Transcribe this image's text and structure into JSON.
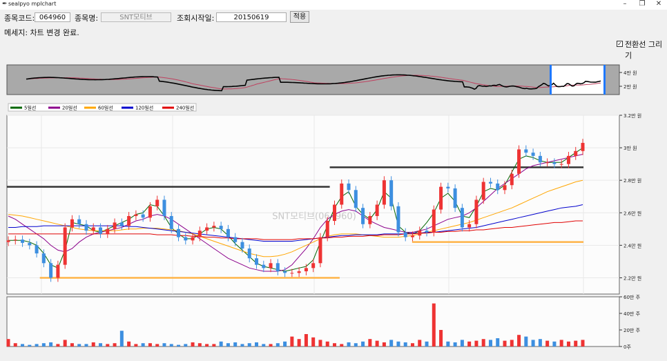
{
  "window": {
    "title": "sealpyo mplchart",
    "app_icon": "feather-icon",
    "min_label": "–",
    "max_label": "❐",
    "close_label": "✕"
  },
  "toolbar": {
    "code_label": "종목코드:",
    "code_value": "064960",
    "name_label": "종목명:",
    "name_value": "SNT모티브",
    "start_label": "조회시작일:",
    "start_value": "20150619",
    "apply_label": "적용"
  },
  "status": {
    "message": "메세지: 차트 변경 완료."
  },
  "options": {
    "transition_label": "전환선 그리기",
    "transition_checked": true
  },
  "legend": [
    {
      "name": "5일선",
      "color": "#006400"
    },
    {
      "name": "20일선",
      "color": "#8b008b"
    },
    {
      "name": "60일선",
      "color": "#ffa500"
    },
    {
      "name": "120일선",
      "color": "#0000cd"
    },
    {
      "name": "240일선",
      "color": "#e00000"
    }
  ],
  "watermark": "SNT모티브(064960)",
  "colors": {
    "up": "#ee3333",
    "down": "#3d8fe0",
    "support": "#ffb347",
    "resistance": "#333333",
    "slider": "#1e78ff"
  },
  "chart_data": {
    "type": "line",
    "overview": {
      "y_ticks": [
        "4만 원",
        "2만 원"
      ]
    },
    "price": {
      "y_ticks": [
        "3.2만 원",
        "3만 원",
        "2.8만 원",
        "2.6만 원",
        "2.4만 원",
        "2.2만 원"
      ],
      "y_values": [
        32000,
        30000,
        28000,
        26000,
        24000,
        22000
      ],
      "ylim": [
        21000,
        32000
      ],
      "x_index_range": [
        0,
        175
      ],
      "close": [
        24300,
        24350,
        24150,
        24000,
        23500,
        22900,
        22000,
        22800,
        25100,
        25600,
        25300,
        24900,
        25100,
        24700,
        25000,
        25400,
        25200,
        25800,
        25900,
        25700,
        26400,
        26800,
        25800,
        25000,
        24500,
        24300,
        24500,
        24900,
        25100,
        25200,
        25000,
        24500,
        24200,
        23800,
        23200,
        22800,
        22600,
        22900,
        22400,
        22300,
        22300,
        22400,
        22600,
        22900,
        24500,
        25500,
        26500,
        27800,
        27400,
        26300,
        25300,
        25800,
        26500,
        28000,
        26400,
        24800,
        24500,
        24600,
        24900,
        24800,
        26200,
        27600,
        27500,
        26300,
        25100,
        25300,
        26800,
        27900,
        27800,
        27400,
        27700,
        28400,
        29900,
        29700,
        29500,
        29100,
        29100,
        29000,
        29000,
        29500,
        29800,
        30300
      ],
      "ma5": [
        24300,
        24300,
        24300,
        24200,
        24000,
        23500,
        22800,
        22600,
        23700,
        25400,
        25300,
        25200,
        24900,
        24800,
        25000,
        25200,
        25400,
        25600,
        25900,
        26000,
        26500,
        26400,
        25800,
        25100,
        24700,
        24400,
        24400,
        24700,
        25000,
        25100,
        25000,
        24600,
        24100,
        23700,
        23300,
        22900,
        22700,
        22600,
        22500,
        22400,
        22500,
        22600,
        22700,
        23100,
        24200,
        25200,
        26300,
        27000,
        27300,
        26400,
        25900,
        25600,
        26200,
        27300,
        26900,
        25200,
        24800,
        24700,
        24900,
        25400,
        26000,
        26900,
        27200,
        26700,
        25800,
        25700,
        26400,
        27300,
        27500,
        27400,
        27700,
        28500,
        29300,
        29500,
        29400,
        29200,
        29100,
        29100,
        29100,
        29400,
        29700,
        30000
      ],
      "ma20": [
        25800,
        25600,
        25300,
        25000,
        24700,
        24400,
        24000,
        23700,
        23600,
        23800,
        24200,
        24500,
        24700,
        24800,
        24900,
        25000,
        25100,
        25300,
        25500,
        25600,
        25800,
        25900,
        25800,
        25600,
        25300,
        25000,
        24700,
        24400,
        24100,
        23800,
        23500,
        23200,
        23000,
        22800,
        22600,
        22500,
        22400,
        22400,
        22400,
        22500,
        22800,
        23300,
        23800,
        24400,
        25100,
        25600,
        25900,
        26100,
        26200,
        26100,
        25800,
        25500,
        25300,
        25100,
        25000,
        24900,
        24800,
        24800,
        24900,
        25000,
        25200,
        25400,
        25600,
        25700,
        25800,
        26000,
        26300,
        26700,
        27100,
        27500,
        27800,
        28100,
        28400,
        28700,
        28900,
        29000,
        29100,
        29200,
        29300,
        29400,
        29500,
        29600
      ],
      "ma60": [
        25900,
        25850,
        25800,
        25700,
        25600,
        25500,
        25400,
        25300,
        25200,
        25100,
        25000,
        24950,
        24900,
        24900,
        24900,
        24900,
        24950,
        25000,
        25000,
        25050,
        25050,
        25050,
        25000,
        24950,
        24900,
        24800,
        24700,
        24550,
        24400,
        24250,
        24100,
        23950,
        23800,
        23650,
        23500,
        23400,
        23300,
        23300,
        23350,
        23450,
        23600,
        23800,
        24000,
        24200,
        24400,
        24550,
        24650,
        24700,
        24700,
        24700,
        24650,
        24600,
        24550,
        24500,
        24500,
        24500,
        24550,
        24600,
        24700,
        24800,
        24900,
        25000,
        25100,
        25200,
        25300,
        25400,
        25550,
        25700,
        25850,
        26000,
        26150,
        26300,
        26500,
        26700,
        26900,
        27100,
        27300,
        27450,
        27600,
        27750,
        27900,
        28000
      ],
      "ma120": [
        25100,
        25100,
        25150,
        25150,
        25150,
        25200,
        25200,
        25200,
        25200,
        25200,
        25200,
        25200,
        25200,
        25200,
        25200,
        25200,
        25200,
        25150,
        25150,
        25100,
        25050,
        25000,
        24950,
        24900,
        24850,
        24800,
        24750,
        24700,
        24650,
        24600,
        24550,
        24500,
        24450,
        24400,
        24350,
        24300,
        24250,
        24250,
        24250,
        24250,
        24250,
        24300,
        24350,
        24400,
        24450,
        24500,
        24550,
        24600,
        24600,
        24650,
        24650,
        24650,
        24650,
        24700,
        24700,
        24700,
        24700,
        24750,
        24750,
        24800,
        24800,
        24850,
        24900,
        24950,
        25000,
        25050,
        25100,
        25200,
        25300,
        25400,
        25500,
        25600,
        25700,
        25800,
        25900,
        26000,
        26100,
        26200,
        26300,
        26350,
        26400,
        26500
      ],
      "ma240": [
        24700,
        24700,
        24700,
        24700,
        24700,
        24700,
        24700,
        24700,
        24700,
        24700,
        24700,
        24700,
        24700,
        24700,
        24700,
        24700,
        24700,
        24700,
        24700,
        24700,
        24700,
        24650,
        24650,
        24650,
        24600,
        24600,
        24550,
        24550,
        24500,
        24500,
        24450,
        24450,
        24400,
        24400,
        24400,
        24400,
        24350,
        24350,
        24350,
        24350,
        24350,
        24400,
        24400,
        24400,
        24450,
        24450,
        24500,
        24500,
        24550,
        24550,
        24550,
        24600,
        24600,
        24650,
        24650,
        24650,
        24700,
        24700,
        24750,
        24750,
        24800,
        24800,
        24850,
        24850,
        24900,
        24900,
        24950,
        24950,
        25000,
        25050,
        25100,
        25100,
        25150,
        25200,
        25250,
        25300,
        25350,
        25400,
        25400,
        25450,
        25500,
        25500
      ],
      "levels": [
        {
          "kind": "resistance",
          "value": 27600,
          "x_from": 0,
          "x_to": 98
        },
        {
          "kind": "resistance",
          "value": 28800,
          "x_from": 98,
          "x_to": 175
        },
        {
          "kind": "support",
          "value": 22000,
          "x_from": 10,
          "x_to": 80
        },
        {
          "kind": "support",
          "value": 22000,
          "x_from": 80,
          "x_to": 101
        },
        {
          "kind": "support",
          "value": 24200,
          "x_from": 123,
          "x_to": 175
        }
      ]
    },
    "volume": {
      "y_ticks": [
        "60만 주",
        "40만 주",
        "20만 주",
        "0주"
      ],
      "ylim": [
        0,
        600000
      ],
      "values": [
        90000,
        40000,
        30000,
        20000,
        30000,
        40000,
        50000,
        30000,
        80000,
        40000,
        30000,
        30000,
        50000,
        40000,
        30000,
        40000,
        190000,
        60000,
        30000,
        40000,
        40000,
        30000,
        40000,
        30000,
        20000,
        30000,
        50000,
        40000,
        30000,
        30000,
        60000,
        40000,
        50000,
        30000,
        40000,
        50000,
        30000,
        30000,
        40000,
        60000,
        120000,
        90000,
        150000,
        110000,
        80000,
        60000,
        40000,
        30000,
        50000,
        40000,
        60000,
        90000,
        70000,
        50000,
        80000,
        60000,
        50000,
        40000,
        80000,
        60000,
        520000,
        200000,
        60000,
        50000,
        80000,
        60000,
        70000,
        90000,
        80000,
        100000,
        70000,
        80000,
        140000,
        120000,
        80000,
        90000,
        70000,
        60000,
        80000,
        60000,
        70000,
        80000
      ]
    }
  }
}
